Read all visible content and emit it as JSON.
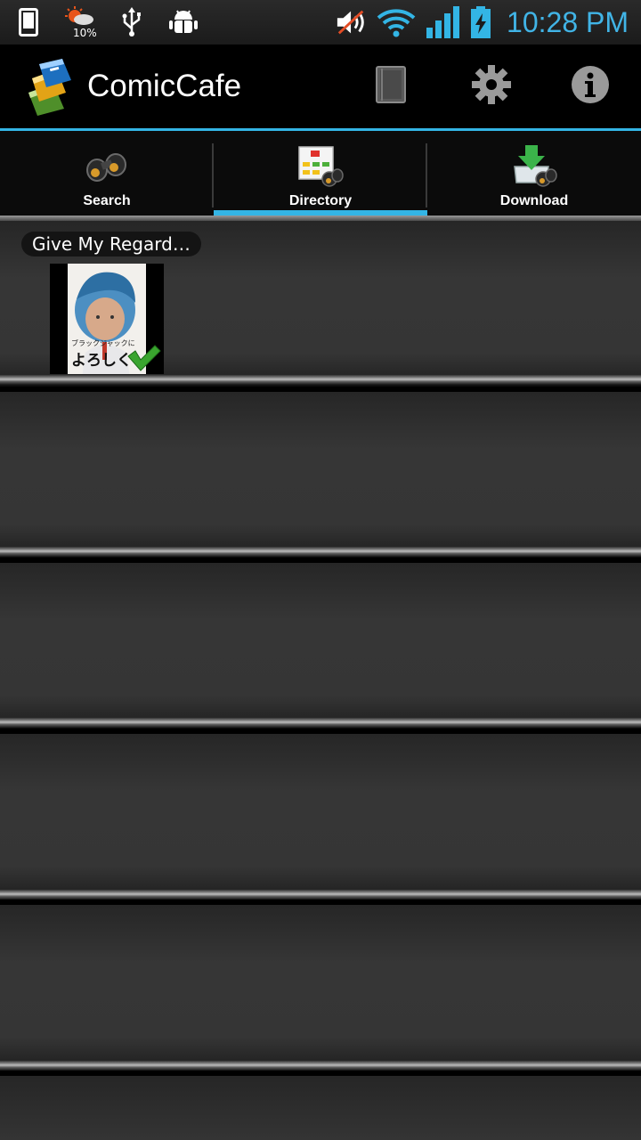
{
  "status_bar": {
    "time": "10:28 PM",
    "weather_percent": "10%",
    "accent_color": "#41b4e6",
    "icons": [
      "phone-icon",
      "weather-icon",
      "usb-icon",
      "android-debug-icon",
      "mute-icon",
      "wifi-icon",
      "signal-icon",
      "battery-charging-icon"
    ]
  },
  "action_bar": {
    "title": "ComicCafe",
    "accent_color": "#33b5e5",
    "buttons": [
      "library-icon",
      "settings-icon",
      "info-icon"
    ]
  },
  "tabs": [
    {
      "label": "Search",
      "icon": "binoculars-icon",
      "selected": false
    },
    {
      "label": "Directory",
      "icon": "directory-icon",
      "selected": true
    },
    {
      "label": "Download",
      "icon": "download-icon",
      "selected": false
    }
  ],
  "shelf": {
    "books": [
      {
        "title": "Give My Regard…",
        "cover_text": "よろしく",
        "cover_subtitle": "ブラックジャックに",
        "downloaded": true
      }
    ]
  }
}
